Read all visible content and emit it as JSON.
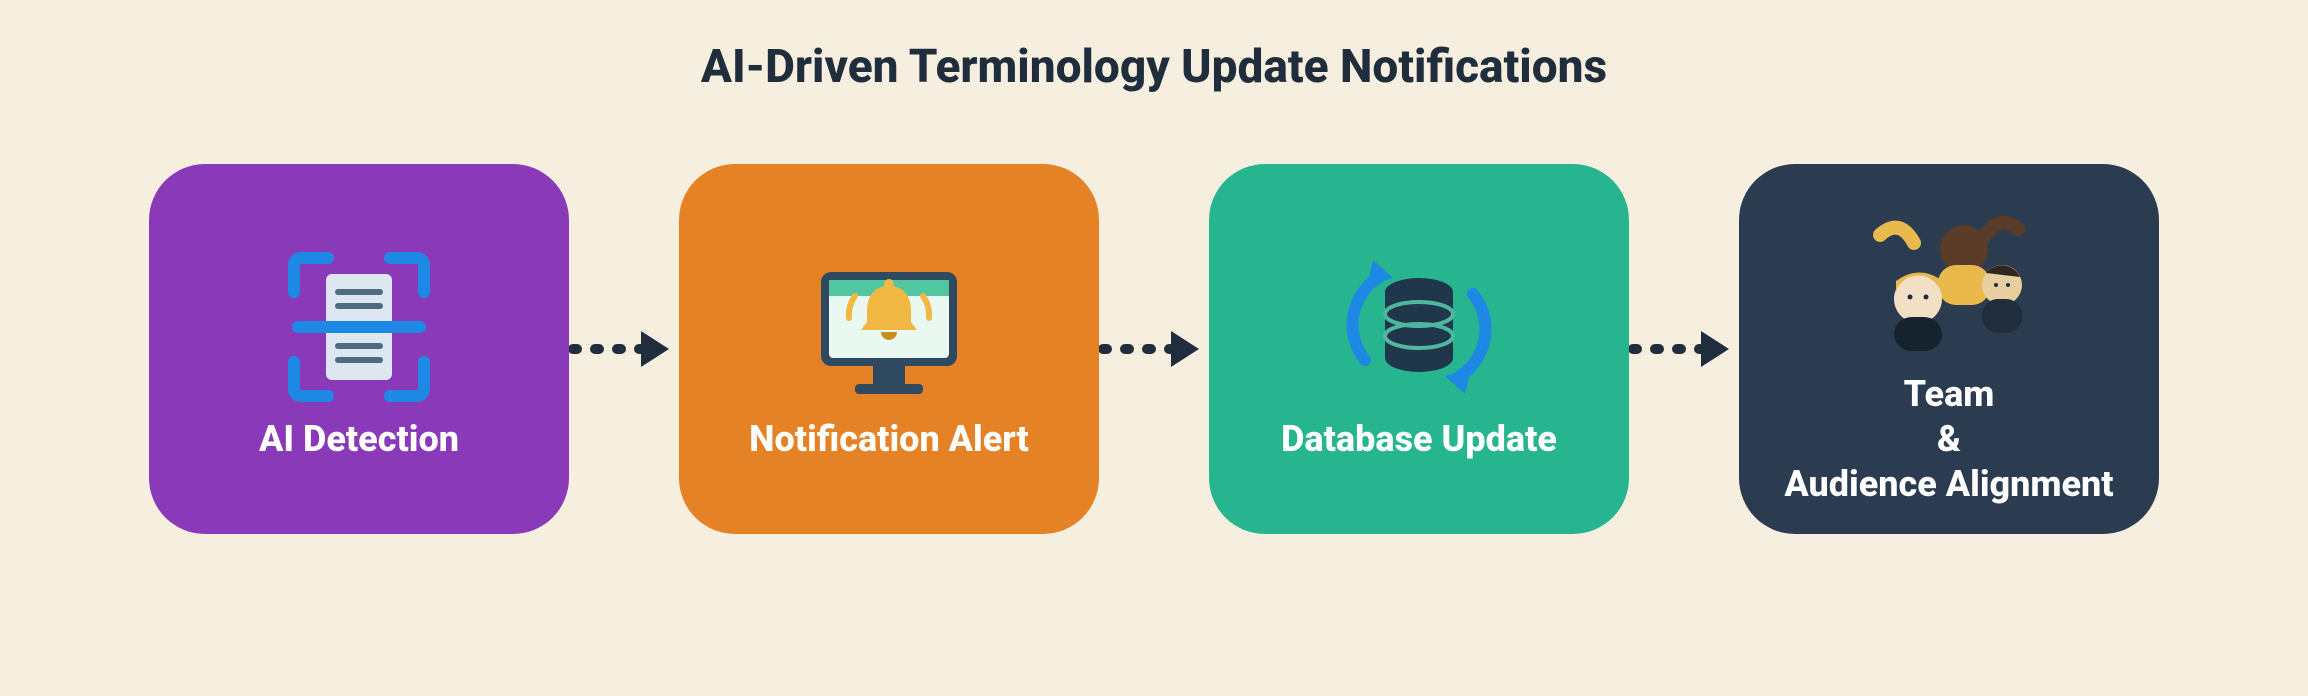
{
  "title": "AI-Driven Terminology Update Notifications",
  "steps": [
    {
      "label": "AI Detection",
      "icon": "document-scan-icon",
      "color": "purple"
    },
    {
      "label": "Notification Alert",
      "icon": "monitor-bell-icon",
      "color": "orange"
    },
    {
      "label": "Database Update",
      "icon": "database-sync-icon",
      "color": "teal"
    },
    {
      "label": "Team\n&\nAudience Alignment",
      "icon": "team-icon",
      "color": "navy"
    }
  ]
}
